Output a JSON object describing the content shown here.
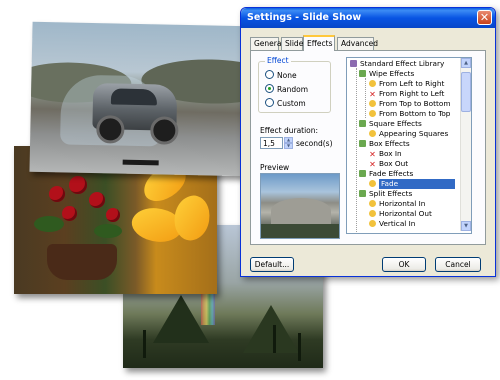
{
  "dialog": {
    "title": "Settings - Slide Show",
    "close_label": "✕",
    "tabs": [
      {
        "label": "General"
      },
      {
        "label": "Slide"
      },
      {
        "label": "Effects"
      },
      {
        "label": "Advanced"
      }
    ],
    "active_tab": "Effects",
    "effect_group": {
      "legend": "Effect",
      "options": [
        "None",
        "Random",
        "Custom"
      ],
      "selected": "Random"
    },
    "duration": {
      "label": "Effect duration:",
      "value": "1,5",
      "unit": "second(s)"
    },
    "preview_label": "Preview",
    "tree": {
      "items": [
        {
          "label": "Standard Effect Library",
          "icon": "library-icon"
        },
        {
          "label": "Wipe Effects",
          "icon": "folder-icon"
        },
        {
          "label": "From Left to Right",
          "icon": "star-icon"
        },
        {
          "label": "From Right to Left",
          "icon": "x-icon"
        },
        {
          "label": "From Top to Bottom",
          "icon": "star-icon"
        },
        {
          "label": "From Bottom to Top",
          "icon": "star-icon"
        },
        {
          "label": "Square Effects",
          "icon": "folder-icon"
        },
        {
          "label": "Appearing Squares",
          "icon": "star-icon"
        },
        {
          "label": "Box Effects",
          "icon": "folder-icon"
        },
        {
          "label": "Box In",
          "icon": "x-icon"
        },
        {
          "label": "Box Out",
          "icon": "x-icon"
        },
        {
          "label": "Fade Effects",
          "icon": "folder-icon"
        },
        {
          "label": "Fade",
          "icon": "star-icon"
        },
        {
          "label": "Split Effects",
          "icon": "folder-icon"
        },
        {
          "label": "Horizontal In",
          "icon": "star-icon"
        },
        {
          "label": "Horizontal Out",
          "icon": "star-icon"
        },
        {
          "label": "Vertical In",
          "icon": "star-icon"
        }
      ],
      "selected": "Fade"
    },
    "buttons": {
      "default": "Default...",
      "ok": "OK",
      "cancel": "Cancel"
    }
  },
  "colors": {
    "title_bar": "#0854e3",
    "dialog_bg": "#ece9d8",
    "selection": "#316ac5",
    "group_legend": "#0046d5"
  }
}
